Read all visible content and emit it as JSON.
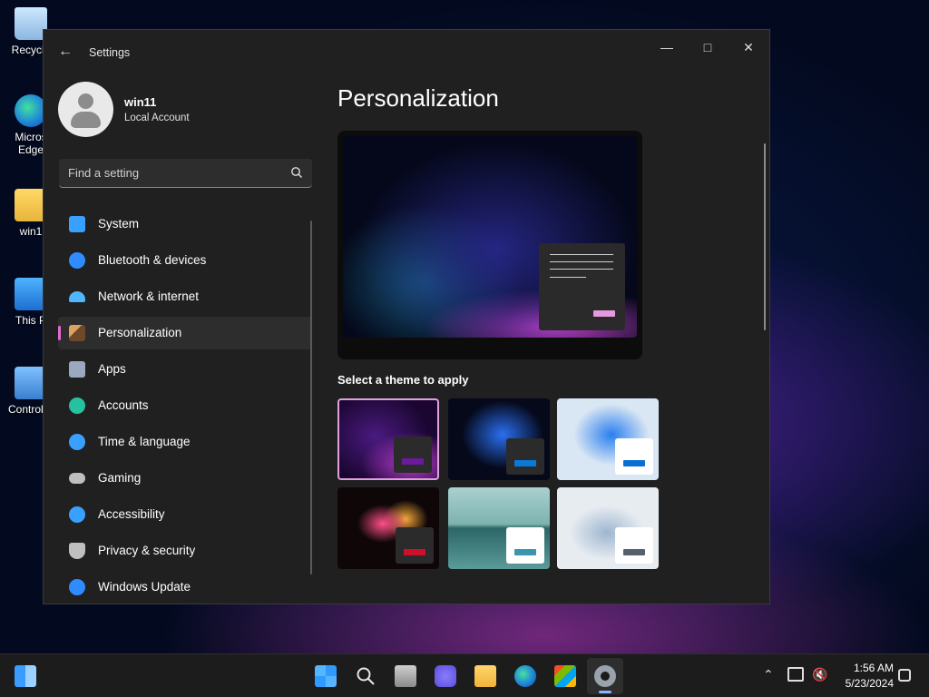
{
  "desktop": {
    "icons": [
      {
        "label": "Recycle"
      },
      {
        "label": "Micros Edge"
      },
      {
        "label": "win1"
      },
      {
        "label": "This P"
      },
      {
        "label": "Control P"
      }
    ]
  },
  "window": {
    "title": "Settings",
    "user": {
      "name": "win11",
      "account_type": "Local Account"
    },
    "search": {
      "placeholder": "Find a setting"
    },
    "nav": [
      {
        "label": "System",
        "icon": "monitor-icon",
        "color": "#3aa0ff"
      },
      {
        "label": "Bluetooth & devices",
        "icon": "bluetooth-icon",
        "color": "#2f8cff"
      },
      {
        "label": "Network & internet",
        "icon": "wifi-icon",
        "color": "#4fb6ff"
      },
      {
        "label": "Personalization",
        "icon": "brush-icon",
        "color": "#e0a060",
        "active": true
      },
      {
        "label": "Apps",
        "icon": "apps-icon",
        "color": "#9aa8c0"
      },
      {
        "label": "Accounts",
        "icon": "person-icon",
        "color": "#25c2a0"
      },
      {
        "label": "Time & language",
        "icon": "globe-clock-icon",
        "color": "#3aa0ff"
      },
      {
        "label": "Gaming",
        "icon": "controller-icon",
        "color": "#bfbfbf"
      },
      {
        "label": "Accessibility",
        "icon": "accessibility-icon",
        "color": "#3aa0ff"
      },
      {
        "label": "Privacy & security",
        "icon": "shield-icon",
        "color": "#bfbfbf"
      },
      {
        "label": "Windows Update",
        "icon": "update-icon",
        "color": "#2f8cff"
      }
    ],
    "main": {
      "title": "Personalization",
      "theme_heading": "Select a theme to apply",
      "themes": [
        {
          "name": "theme-1",
          "accent": "#6a1a9a",
          "selected": true
        },
        {
          "name": "theme-2",
          "accent": "#0a7ad8"
        },
        {
          "name": "theme-3",
          "accent": "#0a6fd0"
        },
        {
          "name": "theme-4",
          "accent": "#d0102a"
        },
        {
          "name": "theme-5",
          "accent": "#3a95ad"
        },
        {
          "name": "theme-6",
          "accent": "#55606c"
        }
      ]
    }
  },
  "taskbar": {
    "clock": {
      "time": "1:56 AM",
      "date": "5/23/2024"
    }
  },
  "colors": {
    "accent": "#e06ad0",
    "window_bg": "#202020"
  }
}
